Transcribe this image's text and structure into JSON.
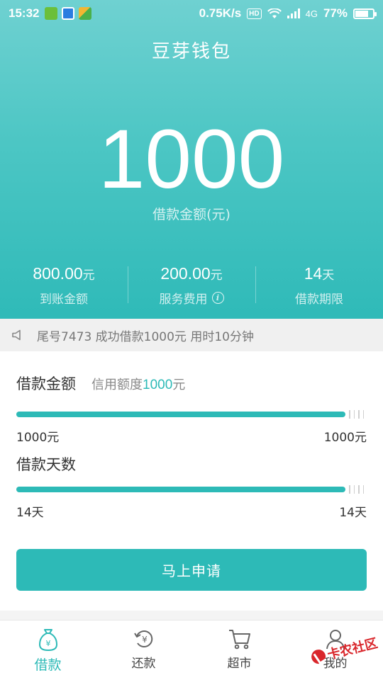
{
  "status_bar": {
    "time": "15:32",
    "network_speed": "0.75K/s",
    "hd": "HD",
    "network_type": "4G",
    "battery": "77%",
    "battery_level": 0.77
  },
  "header": {
    "title": "豆芽钱包"
  },
  "hero": {
    "amount": "1000",
    "amount_label": "借款金额(元)"
  },
  "stats": [
    {
      "value": "800.00",
      "unit": "元",
      "label": "到账金额"
    },
    {
      "value": "200.00",
      "unit": "元",
      "label": "服务费用"
    },
    {
      "value": "14",
      "unit": "天",
      "label": "借款期限"
    }
  ],
  "notice": {
    "text": "尾号7473 成功借款1000元 用时10分钟",
    "icon": "speaker-icon"
  },
  "form": {
    "amount_title": "借款金额",
    "credit_prefix": "信用额度",
    "credit_value": "1000",
    "credit_unit": "元",
    "amount_min": "1000元",
    "amount_max": "1000元",
    "amount_fill": 0.94,
    "days_title": "借款天数",
    "days_min": "14天",
    "days_max": "14天",
    "days_fill": 0.94,
    "apply_label": "马上申请"
  },
  "colors": {
    "accent": "#2dbab7",
    "hero_top": "#6fd1d1",
    "hero_bottom": "#2fbab8"
  },
  "bottom_nav": [
    {
      "label": "借款",
      "icon": "money-bag-icon",
      "active": true
    },
    {
      "label": "还款",
      "icon": "repay-icon",
      "active": false
    },
    {
      "label": "超市",
      "icon": "cart-icon",
      "active": false
    },
    {
      "label": "我的",
      "icon": "profile-icon",
      "active": false
    }
  ],
  "watermark": {
    "text": "卡农社区"
  }
}
